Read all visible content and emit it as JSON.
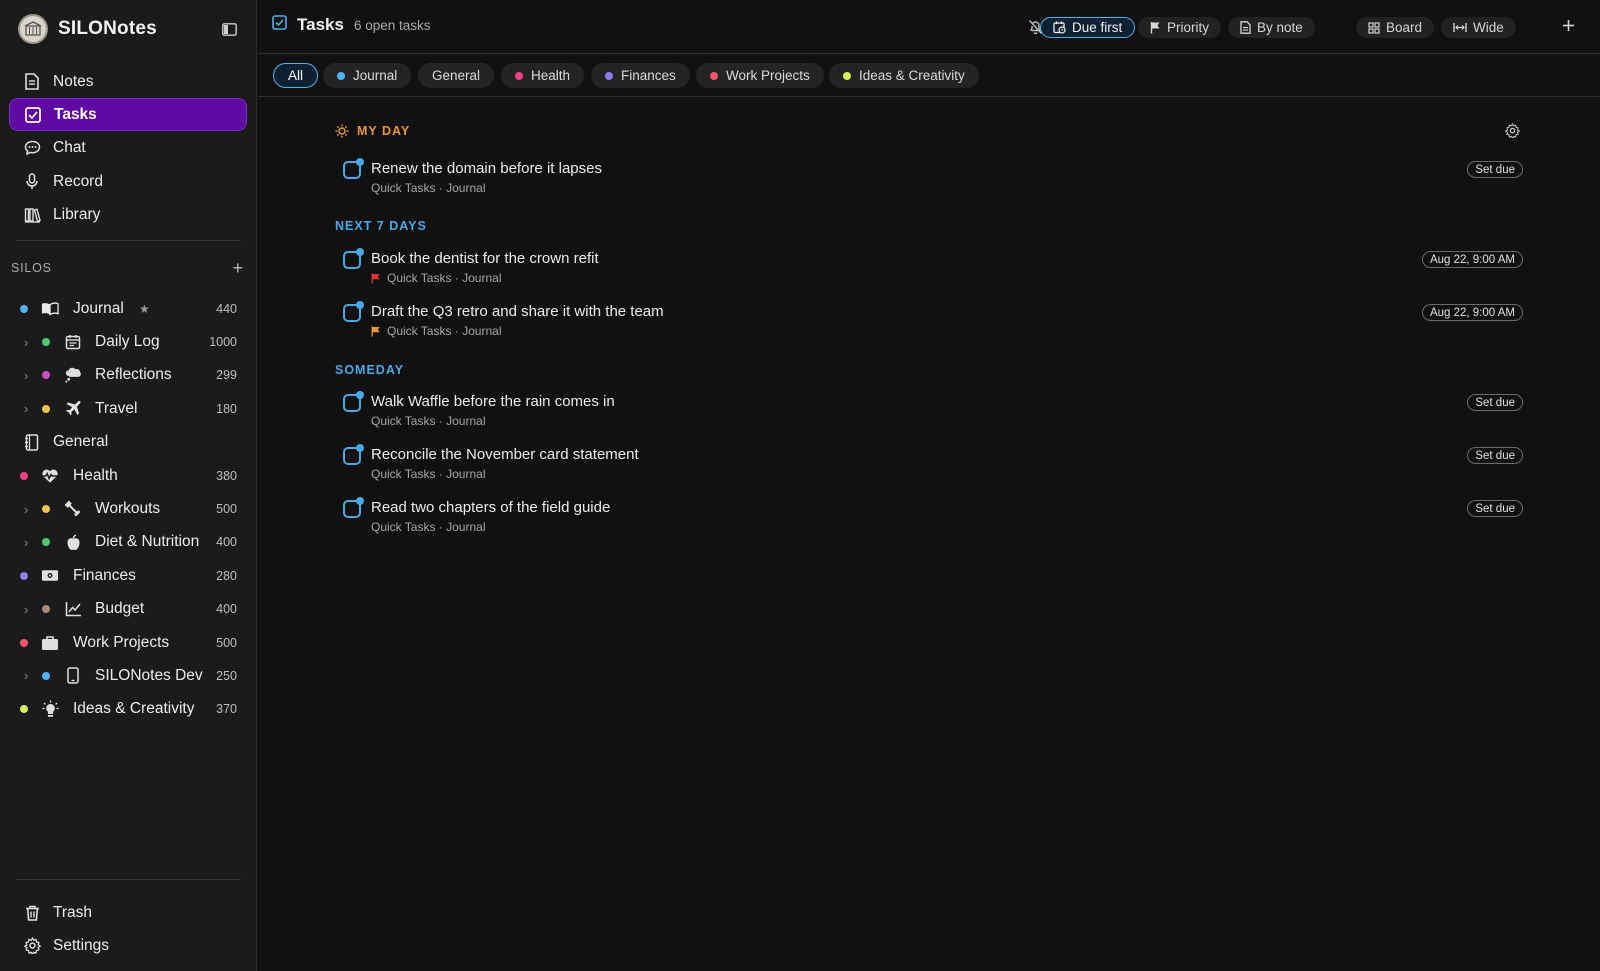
{
  "app": {
    "title": "SILONotes"
  },
  "nav": {
    "items": [
      {
        "label": "Notes",
        "icon": "document-icon",
        "active": false
      },
      {
        "label": "Tasks",
        "icon": "checkbox-icon",
        "active": true
      },
      {
        "label": "Chat",
        "icon": "chat-bubble-icon",
        "active": false
      },
      {
        "label": "Record",
        "icon": "microphone-icon",
        "active": false
      },
      {
        "label": "Library",
        "icon": "books-icon",
        "active": false
      }
    ],
    "bottom": [
      {
        "label": "Trash",
        "icon": "trash-icon"
      },
      {
        "label": "Settings",
        "icon": "gear-icon"
      }
    ]
  },
  "silos": {
    "heading": "SILOS",
    "add_label": "+",
    "items": [
      {
        "name": "Journal",
        "count": "440",
        "color": "#4fb3f0",
        "icon": "open-book-icon",
        "level": "top",
        "star": "★"
      },
      {
        "name": "Daily Log",
        "count": "1000",
        "color": "#4ecb72",
        "icon": "calendar-icon",
        "level": "sub"
      },
      {
        "name": "Reflections",
        "count": "299",
        "color": "#c94ec4",
        "icon": "thought-bubble-icon",
        "level": "sub"
      },
      {
        "name": "Travel",
        "count": "180",
        "color": "#f0c24f",
        "icon": "airplane-icon",
        "level": "sub"
      },
      {
        "name": "General",
        "count": "",
        "color": "",
        "icon": "notebook-icon",
        "level": "plain"
      },
      {
        "name": "Health",
        "count": "380",
        "color": "#ef3f86",
        "icon": "heartbeat-icon",
        "level": "top"
      },
      {
        "name": "Workouts",
        "count": "500",
        "color": "#f0c24f",
        "icon": "dumbbell-icon",
        "level": "sub"
      },
      {
        "name": "Diet & Nutrition",
        "count": "400",
        "color": "#4ecb72",
        "icon": "apple-icon",
        "level": "sub"
      },
      {
        "name": "Finances",
        "count": "280",
        "color": "#8b7cf0",
        "icon": "banknote-icon",
        "level": "top"
      },
      {
        "name": "Budget",
        "count": "400",
        "color": "#a88a7a",
        "icon": "line-chart-icon",
        "level": "sub"
      },
      {
        "name": "Work Projects",
        "count": "500",
        "color": "#f2546b",
        "icon": "briefcase-icon",
        "level": "top"
      },
      {
        "name": "SILONotes Dev",
        "count": "250",
        "color": "#4fb3f0",
        "icon": "phone-icon",
        "level": "sub"
      },
      {
        "name": "Ideas & Creativity",
        "count": "370",
        "color": "#d9ef5a",
        "icon": "lightbulb-icon",
        "level": "top"
      }
    ]
  },
  "header": {
    "title": "Tasks",
    "open_count": "6 open tasks",
    "tools": [
      {
        "label": "",
        "icon": "bell-off-icon",
        "name": "mute-button"
      },
      {
        "label": "Due first",
        "icon": "calendar-clock-icon",
        "name": "due-first-button",
        "active": true
      },
      {
        "label": "Priority",
        "icon": "flag-icon",
        "name": "priority-button"
      },
      {
        "label": "By note",
        "icon": "note-icon",
        "name": "by-note-button"
      },
      {
        "label": "Board",
        "icon": "grid-icon",
        "name": "board-button"
      },
      {
        "label": "Wide",
        "icon": "wide-icon",
        "name": "wide-button"
      },
      {
        "label": "",
        "icon": "plus-icon",
        "name": "add-task-button"
      }
    ]
  },
  "filters": [
    {
      "label": "All",
      "color": "",
      "active": true
    },
    {
      "label": "Journal",
      "color": "#4fb3f0"
    },
    {
      "label": "General",
      "color": ""
    },
    {
      "label": "Health",
      "color": "#ef3f86"
    },
    {
      "label": "Finances",
      "color": "#8b7cf0"
    },
    {
      "label": "Work Projects",
      "color": "#f2546b"
    },
    {
      "label": "Ideas & Creativity",
      "color": "#d9ef5a"
    }
  ],
  "sections": [
    {
      "heading": "MY DAY",
      "tasks": [
        {
          "title": "Renew the domain before it lapses",
          "meta": "Quick Tasks · Journal",
          "due": "Set due",
          "flag": ""
        }
      ]
    },
    {
      "heading": "NEXT 7 DAYS",
      "tasks": [
        {
          "title": "Book the dentist for the crown refit",
          "meta": "Quick Tasks · Journal",
          "due": "Aug 22, 9:00 AM",
          "flag": "#e0303a"
        },
        {
          "title": "Draft the Q3 retro and share it with the team",
          "meta": "Quick Tasks · Journal",
          "due": "Aug 22, 9:00 AM",
          "flag": "#e8943a"
        }
      ]
    },
    {
      "heading": "SOMEDAY",
      "tasks": [
        {
          "title": "Walk Waffle before the rain comes in",
          "meta": "Quick Tasks · Journal",
          "due": "Set due",
          "flag": ""
        },
        {
          "title": "Reconcile the November card statement",
          "meta": "Quick Tasks · Journal",
          "due": "Set due",
          "flag": ""
        },
        {
          "title": "Read two chapters of the field guide",
          "meta": "Quick Tasks · Journal",
          "due": "Set due",
          "flag": ""
        }
      ]
    }
  ]
}
